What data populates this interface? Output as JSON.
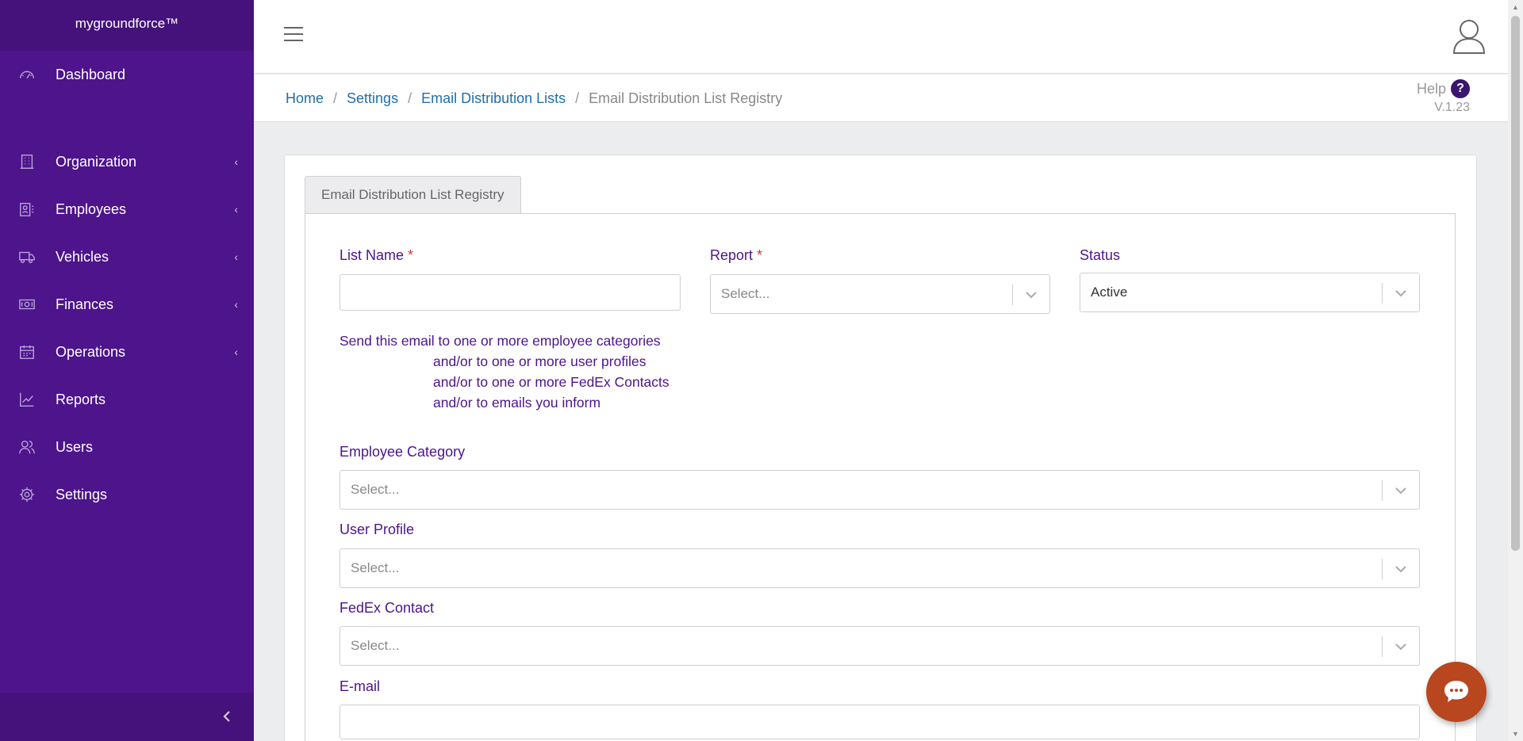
{
  "app": {
    "brand": "mygroundforce™"
  },
  "sidebar": {
    "items": [
      {
        "label": "Dashboard",
        "icon": "dashboard-icon",
        "chevron": ""
      },
      {
        "label": "Organization",
        "icon": "building-icon",
        "chevron": "‹"
      },
      {
        "label": "Employees",
        "icon": "employee-badge-icon",
        "chevron": "‹"
      },
      {
        "label": "Vehicles",
        "icon": "truck-icon",
        "chevron": "‹"
      },
      {
        "label": "Finances",
        "icon": "money-icon",
        "chevron": "‹"
      },
      {
        "label": "Operations",
        "icon": "calendar-icon",
        "chevron": "‹"
      },
      {
        "label": "Reports",
        "icon": "chart-line-icon",
        "chevron": ""
      },
      {
        "label": "Users",
        "icon": "users-icon",
        "chevron": ""
      },
      {
        "label": "Settings",
        "icon": "gear-icon",
        "chevron": ""
      }
    ]
  },
  "breadcrumb": {
    "items": [
      "Home",
      "Settings",
      "Email Distribution Lists"
    ],
    "current": "Email Distribution List Registry",
    "separator": "/"
  },
  "help": {
    "label": "Help",
    "icon_text": "?",
    "version": "V.1.23"
  },
  "form": {
    "tab_label": "Email Distribution List Registry",
    "list_name": {
      "label": "List Name",
      "required": "*",
      "value": ""
    },
    "report": {
      "label": "Report",
      "required": "*",
      "placeholder": "Select..."
    },
    "status": {
      "label": "Status",
      "value": "Active"
    },
    "info_lines": [
      "Send this email to one or more employee categories",
      "and/or to one or more user profiles",
      "and/or to one or more FedEx Contacts",
      "and/or to emails you inform"
    ],
    "employee_category": {
      "label": "Employee Category",
      "placeholder": "Select..."
    },
    "user_profile": {
      "label": "User Profile",
      "placeholder": "Select..."
    },
    "fedex_contact": {
      "label": "FedEx Contact",
      "placeholder": "Select..."
    },
    "email": {
      "label": "E-mail",
      "value": ""
    }
  },
  "colors": {
    "sidebar": "#4d148c",
    "label": "#4d148c",
    "link": "#1f6fa8",
    "chat": "#b8461e"
  }
}
